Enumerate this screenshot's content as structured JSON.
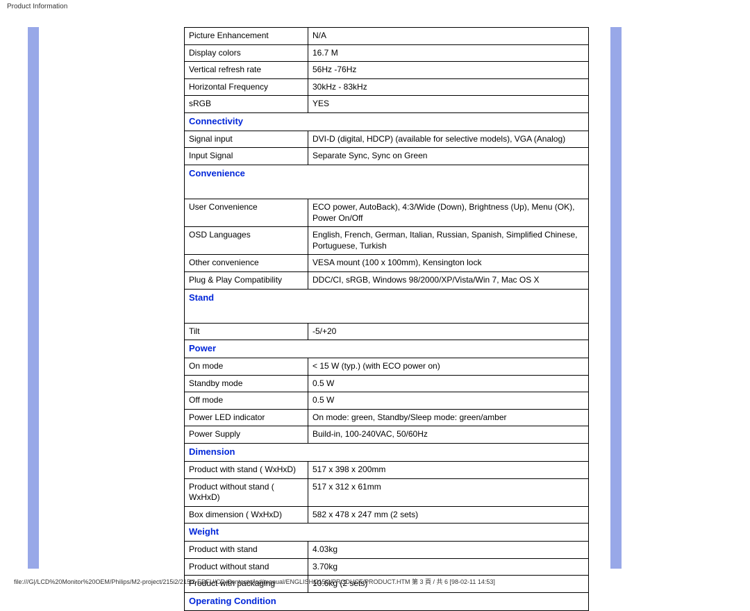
{
  "header": {
    "title": "Product Information"
  },
  "footer": {
    "path": "file:///G|/LCD%20Monitor%20OEM/Philips/M2-project/215i2/215i2-EDFU/CD-Contents/lcd/manual/ENGLISH/215i2/PRODUCT/PRODUCT.HTM 第 3 頁 / 共 6  [98-02-11 14:53]"
  },
  "rows": {
    "r0": {
      "label": "Picture Enhancement",
      "value": "N/A"
    },
    "r1": {
      "label": "Display colors",
      "value": "16.7 M"
    },
    "r2": {
      "label": "Vertical refresh rate",
      "value": "56Hz -76Hz"
    },
    "r3": {
      "label": "Horizontal Frequency",
      "value": "30kHz - 83kHz"
    },
    "r4": {
      "label": "sRGB",
      "value": "YES"
    },
    "s1": "Connectivity",
    "r5": {
      "label": "Signal input",
      "value": "DVI-D (digital, HDCP) (available for selective models), VGA (Analog)"
    },
    "r6": {
      "label": "Input Signal",
      "value": "Separate Sync, Sync on Green"
    },
    "s2": "Convenience",
    "r7": {
      "label": "User Convenience",
      "value": "ECO power, AutoBack), 4:3/Wide (Down), Brightness (Up), Menu (OK), Power On/Off"
    },
    "r8": {
      "label": "OSD Languages",
      "value": "English, French, German, Italian, Russian, Spanish, Simplified Chinese, Portuguese, Turkish"
    },
    "r9": {
      "label": "Other convenience",
      "value": "VESA mount (100 x 100mm), Kensington lock"
    },
    "r10": {
      "label": "Plug & Play Compatibility",
      "value": "DDC/CI, sRGB, Windows 98/2000/XP/Vista/Win 7, Mac OS X"
    },
    "s3": "Stand",
    "r11": {
      "label": "Tilt",
      "value": "-5/+20"
    },
    "s4": "Power",
    "r12": {
      "label": "On mode",
      "value": "< 15 W (typ.) (with ECO power on)"
    },
    "r13": {
      "label": "Standby mode",
      "value": "0.5 W"
    },
    "r14": {
      "label": "Off mode",
      "value": "0.5 W"
    },
    "r15": {
      "label": "Power LED indicator",
      "value": "On mode: green, Standby/Sleep mode: green/amber"
    },
    "r16": {
      "label": "Power Supply",
      "value": "Build-in, 100-240VAC, 50/60Hz"
    },
    "s5": "Dimension",
    "r17": {
      "label": "Product with stand ( WxHxD)",
      "value": "517 x 398 x 200mm"
    },
    "r18": {
      "label": "Product without stand ( WxHxD)",
      "value": "517 x 312 x 61mm"
    },
    "r19": {
      "label": "Box dimension ( WxHxD)",
      "value": "582 x 478 x 247 mm (2 sets)"
    },
    "s6": "Weight",
    "r20": {
      "label": "Product with stand",
      "value": "4.03kg"
    },
    "r21": {
      "label": "Product without stand",
      "value": "3.70kg"
    },
    "r22": {
      "label": "Product with packaging",
      "value": "10.6kg (2 sets)"
    },
    "s7": "Operating Condition"
  }
}
